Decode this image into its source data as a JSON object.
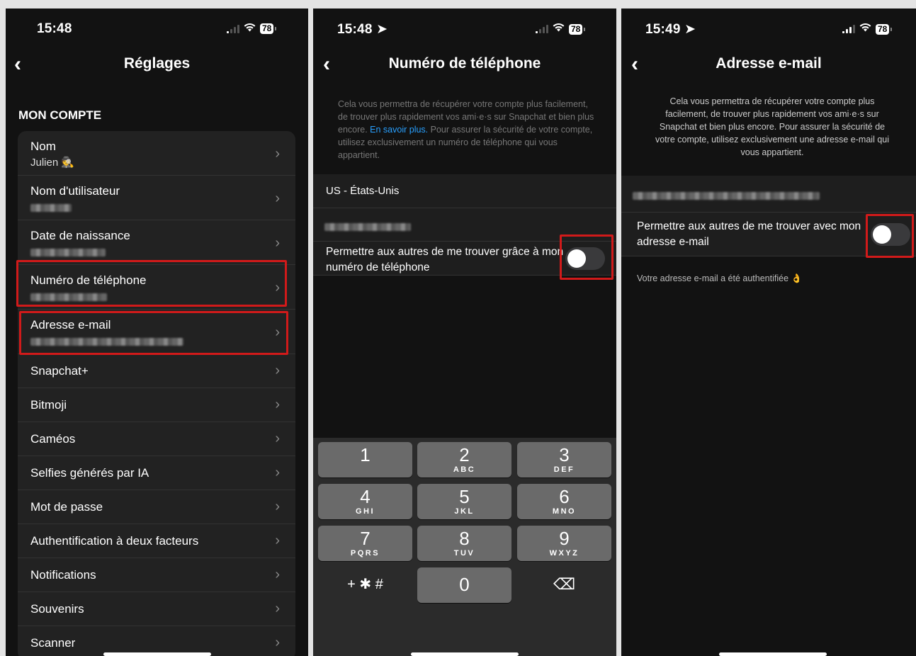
{
  "screen1": {
    "time": "15:48",
    "battery": "78",
    "title": "Réglages",
    "section": "MON COMPTE",
    "rows": [
      {
        "label": "Nom",
        "sub": "Julien 🕵"
      },
      {
        "label": "Nom d'utilisateur"
      },
      {
        "label": "Date de naissance"
      },
      {
        "label": "Numéro de téléphone"
      },
      {
        "label": "Adresse e-mail"
      },
      {
        "label": "Snapchat+"
      },
      {
        "label": "Bitmoji"
      },
      {
        "label": "Caméos"
      },
      {
        "label": "Selfies générés par IA"
      },
      {
        "label": "Mot de passe"
      },
      {
        "label": "Authentification à deux facteurs"
      },
      {
        "label": "Notifications"
      },
      {
        "label": "Souvenirs"
      },
      {
        "label": "Scanner"
      }
    ]
  },
  "screen2": {
    "time": "15:48",
    "battery": "78",
    "title": "Numéro de téléphone",
    "desc_before": "Cela vous permettra de récupérer votre compte plus facilement, de trouver plus rapidement vos ami·e·s sur Snapchat et bien plus encore. ",
    "desc_link": "En savoir plus.",
    "desc_after": " Pour assurer la sécurité de votre compte, utilisez exclusivement un numéro de téléphone qui vous appartient.",
    "country": "US - États-Unis",
    "toggle_label": "Permettre aux autres de me trouver grâce à mon numéro de téléphone",
    "toggle_on": false,
    "keys": [
      {
        "n": "1",
        "l": ""
      },
      {
        "n": "2",
        "l": "ABC"
      },
      {
        "n": "3",
        "l": "DEF"
      },
      {
        "n": "4",
        "l": "GHI"
      },
      {
        "n": "5",
        "l": "JKL"
      },
      {
        "n": "6",
        "l": "MNO"
      },
      {
        "n": "7",
        "l": "PQRS"
      },
      {
        "n": "8",
        "l": "TUV"
      },
      {
        "n": "9",
        "l": "WXYZ"
      },
      {
        "n": "+ ✱ #",
        "l": ""
      },
      {
        "n": "0",
        "l": ""
      },
      {
        "n": "⌫",
        "l": ""
      }
    ]
  },
  "screen3": {
    "time": "15:49",
    "battery": "78",
    "title": "Adresse e-mail",
    "desc": "Cela vous permettra de récupérer votre compte plus facilement, de trouver plus rapidement vos ami·e·s sur Snapchat et bien plus encore. Pour assurer la sécurité de votre compte, utilisez exclusivement une adresse e-mail qui vous appartient.",
    "toggle_label": "Permettre aux autres de me trouver avec mon adresse e-mail",
    "toggle_on": false,
    "verified": "Votre adresse e-mail a été authentifiée 👌"
  },
  "colors": {
    "highlight": "#d11a1a",
    "link": "#28a0ff",
    "background": "#121212"
  }
}
